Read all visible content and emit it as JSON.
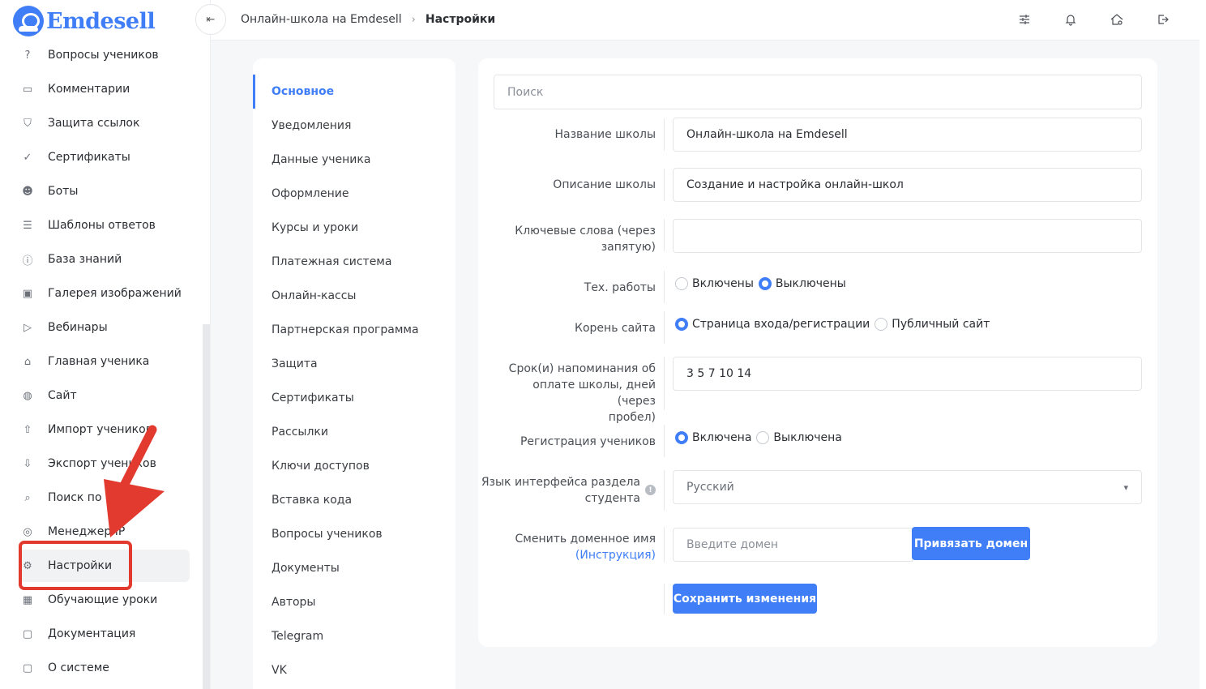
{
  "app": {
    "logo_text": "Emdesell",
    "accent": "#3f7ef6"
  },
  "sidebar": {
    "items": [
      {
        "label": "Вопросы учеников",
        "icon": "question-circle-icon"
      },
      {
        "label": "Комментарии",
        "icon": "chat-icon"
      },
      {
        "label": "Защита ссылок",
        "icon": "shield-icon"
      },
      {
        "label": "Сертификаты",
        "icon": "certificate-icon"
      },
      {
        "label": "Боты",
        "icon": "robot-icon"
      },
      {
        "label": "Шаблоны ответов",
        "icon": "list-icon"
      },
      {
        "label": "База знаний",
        "icon": "info-circle-icon"
      },
      {
        "label": "Галерея изображений",
        "icon": "image-icon"
      },
      {
        "label": "Вебинары",
        "icon": "play-icon"
      },
      {
        "label": "Главная ученика",
        "icon": "home-icon"
      },
      {
        "label": "Сайт",
        "icon": "globe-icon"
      },
      {
        "label": "Импорт учеников",
        "icon": "upload-icon"
      },
      {
        "label": "Экспорт учеников",
        "icon": "download-icon"
      },
      {
        "label": "Поиск по курсам",
        "icon": "search-icon"
      },
      {
        "label": "Менеджер IP",
        "icon": "target-icon"
      },
      {
        "label": "Настройки",
        "icon": "gear-icon"
      },
      {
        "label": "Обучающие уроки",
        "icon": "film-icon"
      },
      {
        "label": "Документация",
        "icon": "help-box-icon"
      },
      {
        "label": "О системе",
        "icon": "info-box-icon"
      }
    ],
    "active_index": 15
  },
  "header": {
    "collapse_glyph": "⇤",
    "breadcrumb_parent": "Онлайн-школа на Emdesell",
    "breadcrumb_sep": "›",
    "breadcrumb_current": "Настройки"
  },
  "settings_nav": {
    "items": [
      "Основное",
      "Уведомления",
      "Данные ученика",
      "Оформление",
      "Курсы и уроки",
      "Платежная система",
      "Онлайн-кассы",
      "Партнерская программа",
      "Защита",
      "Сертификаты",
      "Рассылки",
      "Ключи доступов",
      "Вставка кода",
      "Вопросы учеников",
      "Документы",
      "Авторы",
      "Telegram",
      "VK"
    ],
    "active_index": 0
  },
  "form": {
    "search_placeholder": "Поиск",
    "school_name": {
      "label": "Название школы",
      "value": "Онлайн-школа на Emdesell"
    },
    "school_desc": {
      "label": "Описание школы",
      "value": "Создание и настройка онлайн-школ"
    },
    "keywords": {
      "label_line1": "Ключевые слова (через",
      "label_line2": "запятую)",
      "value": ""
    },
    "maintenance": {
      "label": "Тех. работы",
      "options": [
        "Включены",
        "Выключены"
      ],
      "selected": 1
    },
    "site_root": {
      "label": "Корень сайта",
      "options": [
        "Страница входа/регистрации",
        "Публичный сайт"
      ],
      "selected": 0
    },
    "reminders": {
      "label_line1": "Срок(и) напоминания об",
      "label_line2": "оплате школы, дней (через",
      "label_line3": "пробел)",
      "value": "3 5 7 10 14"
    },
    "registration": {
      "label": "Регистрация учеников",
      "options": [
        "Включена",
        "Выключена"
      ],
      "selected": 0
    },
    "language": {
      "label_line1": "Язык интерфейса раздела",
      "label_line2": "студента",
      "value": "Русский"
    },
    "domain": {
      "label_line1": "Сменить доменное имя",
      "label_link": "(Инструкция)",
      "placeholder": "Введите домен",
      "button": "Привязать домен"
    },
    "save_button": "Сохранить изменения"
  }
}
